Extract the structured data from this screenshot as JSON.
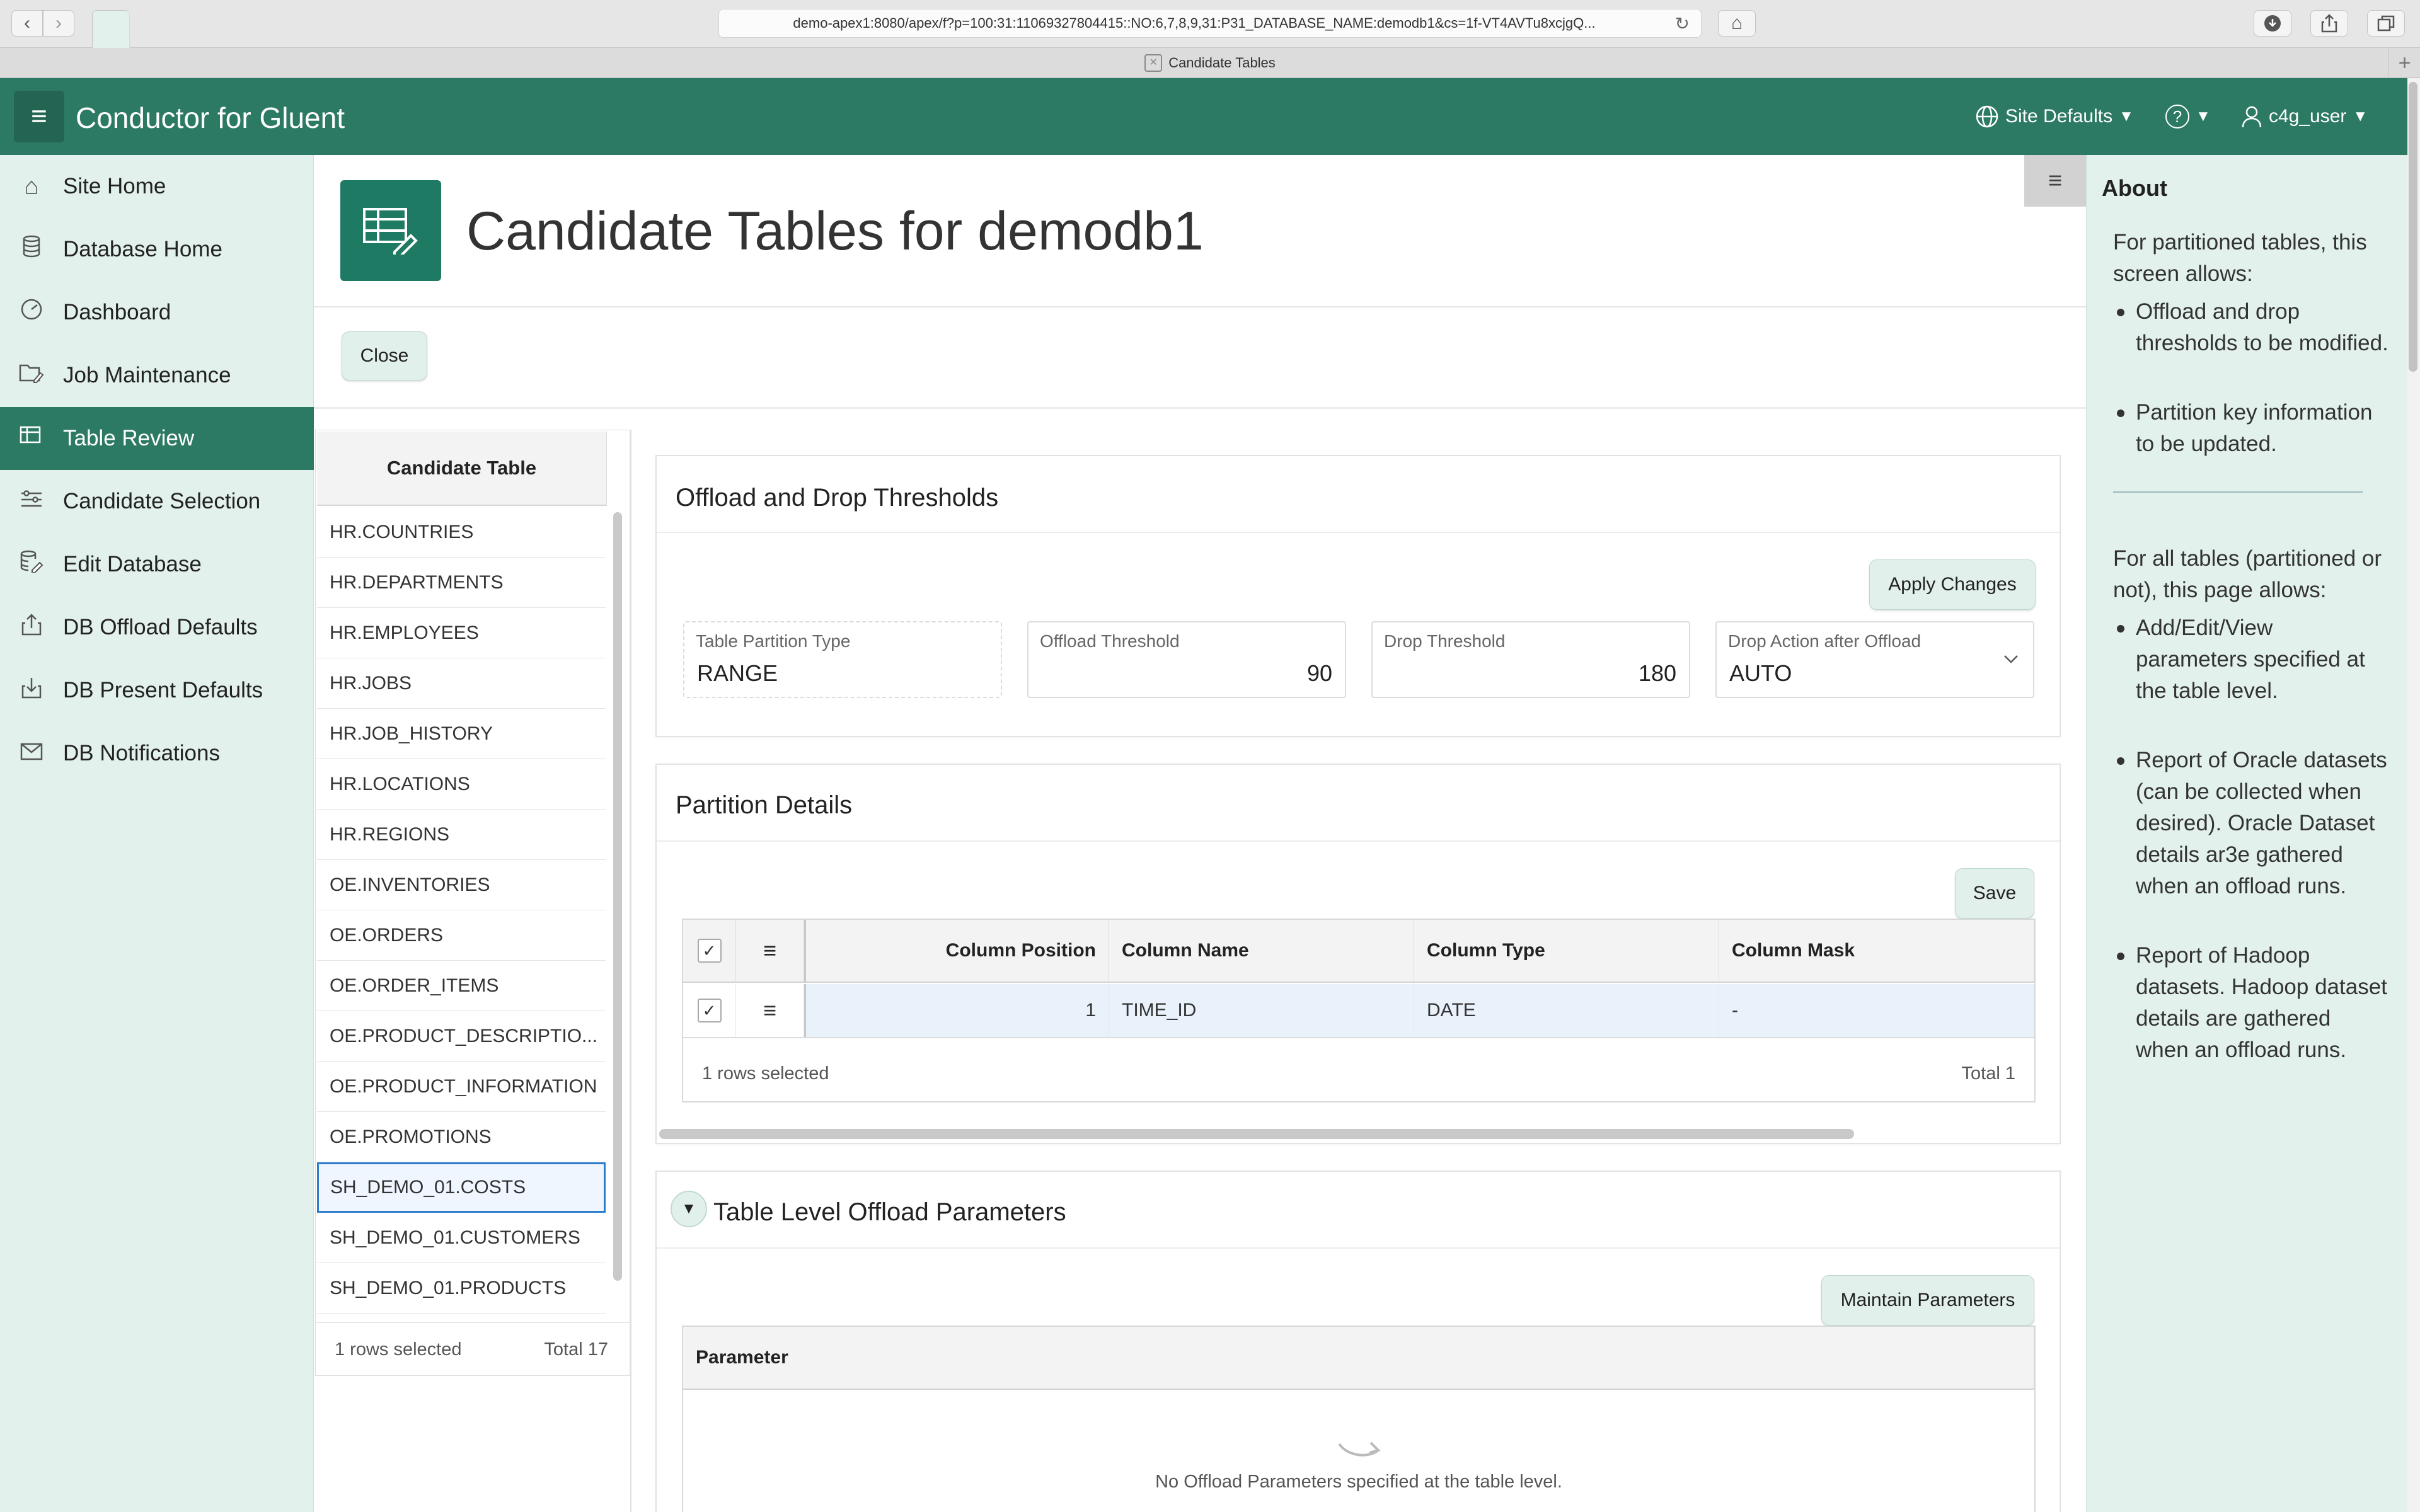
{
  "browser": {
    "url": "demo-apex1:8080/apex/f?p=100:31:11069327804415::NO:6,7,8,9,31:P31_DATABASE_NAME:demodb1&cs=1f-VT4AVTu8xcjgQ...",
    "tab_title": "Candidate Tables"
  },
  "header": {
    "app_title": "Conductor for Gluent",
    "site_defaults": "Site Defaults",
    "help": "?",
    "user": "c4g_user"
  },
  "sidebar": {
    "items": [
      {
        "label": "Site Home",
        "icon": "home-icon"
      },
      {
        "label": "Database Home",
        "icon": "database-icon"
      },
      {
        "label": "Dashboard",
        "icon": "gauge-icon"
      },
      {
        "label": "Job Maintenance",
        "icon": "folder-edit-icon"
      },
      {
        "label": "Table Review",
        "icon": "table-edit-icon"
      },
      {
        "label": "Candidate Selection",
        "icon": "sliders-icon"
      },
      {
        "label": "Edit Database",
        "icon": "database-edit-icon"
      },
      {
        "label": "DB Offload Defaults",
        "icon": "upload-icon"
      },
      {
        "label": "DB Present Defaults",
        "icon": "download-icon"
      },
      {
        "label": "DB Notifications",
        "icon": "mail-icon"
      }
    ],
    "active_index": 4
  },
  "page": {
    "title": "Candidate Tables for demodb1",
    "close_label": "Close"
  },
  "candidate_list": {
    "header": "Candidate Table",
    "rows": [
      "HR.COUNTRIES",
      "HR.DEPARTMENTS",
      "HR.EMPLOYEES",
      "HR.JOBS",
      "HR.JOB_HISTORY",
      "HR.LOCATIONS",
      "HR.REGIONS",
      "OE.INVENTORIES",
      "OE.ORDERS",
      "OE.ORDER_ITEMS",
      "OE.PRODUCT_DESCRIPTIO...",
      "OE.PRODUCT_INFORMATION",
      "OE.PROMOTIONS",
      "SH_DEMO_01.COSTS",
      "SH_DEMO_01.CUSTOMERS",
      "SH_DEMO_01.PRODUCTS"
    ],
    "selected_index": 13,
    "footer_selected": "1 rows selected",
    "footer_total": "Total 17"
  },
  "thresholds": {
    "title": "Offload and Drop Thresholds",
    "apply_label": "Apply Changes",
    "partition_type_label": "Table Partition Type",
    "partition_type_value": "RANGE",
    "offload_threshold_label": "Offload Threshold",
    "offload_threshold_value": "90",
    "drop_threshold_label": "Drop Threshold",
    "drop_threshold_value": "180",
    "drop_action_label": "Drop Action after Offload",
    "drop_action_value": "AUTO"
  },
  "partition_details": {
    "title": "Partition Details",
    "save_label": "Save",
    "columns": [
      "Column Position",
      "Column Name",
      "Column Type",
      "Column Mask"
    ],
    "rows": [
      {
        "position": "1",
        "name": "TIME_ID",
        "type": "DATE",
        "mask": "-"
      }
    ],
    "footer_selected": "1 rows selected",
    "footer_total": "Total 1"
  },
  "offload_params": {
    "title": "Table Level Offload Parameters",
    "maintain_label": "Maintain Parameters",
    "column": "Parameter",
    "empty_message": "No Offload Parameters specified at the table level."
  },
  "about": {
    "title": "About",
    "intro1": "For partitioned tables, this screen allows:",
    "bullets1": [
      "Offload and drop thresholds to be modified.",
      "Partition key information to be updated."
    ],
    "intro2": "For all tables (partitioned or not), this page allows:",
    "bullets2": [
      "Add/Edit/View parameters specified at the table level.",
      "Report of Oracle datasets (can be collected when desired). Oracle Dataset details ar3e gathered when an offload runs.",
      "Report of Hadoop datasets. Hadoop dataset details are gathered when an offload runs."
    ]
  }
}
